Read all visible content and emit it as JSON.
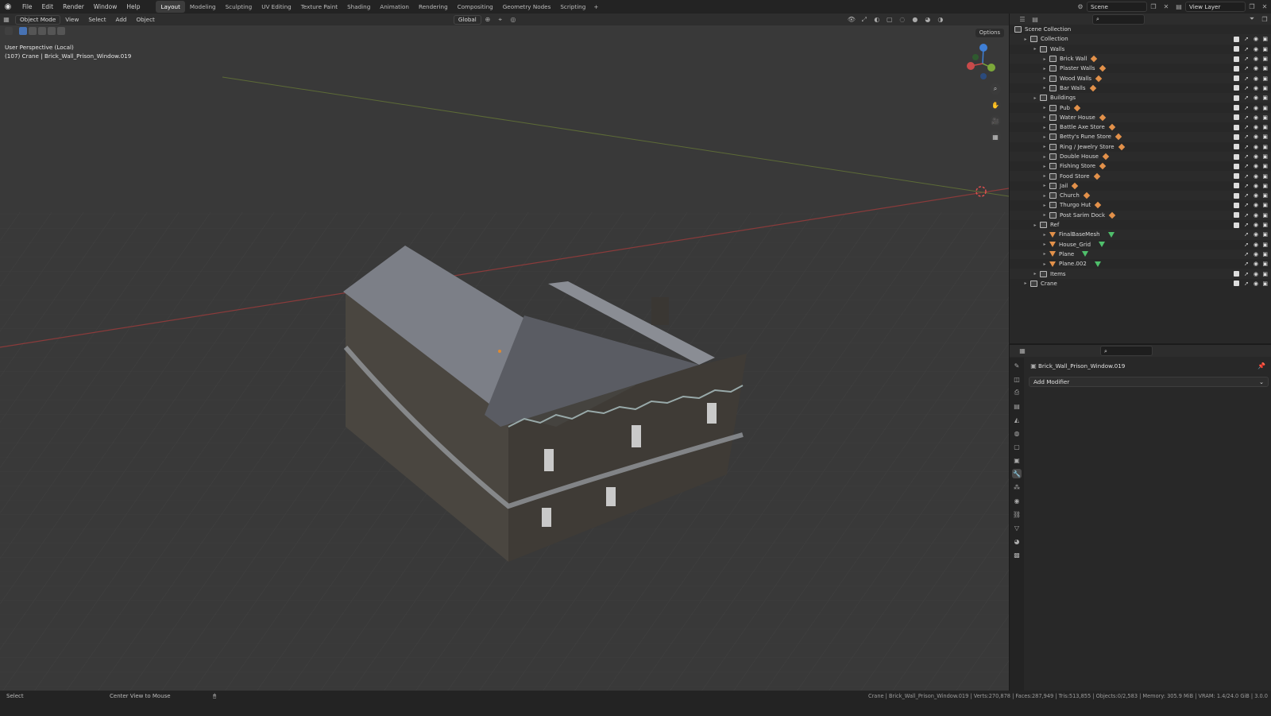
{
  "topbar": {
    "menus": [
      "File",
      "Edit",
      "Render",
      "Window",
      "Help"
    ],
    "workspaces": [
      "Layout",
      "Modeling",
      "Sculpting",
      "UV Editing",
      "Texture Paint",
      "Shading",
      "Animation",
      "Rendering",
      "Compositing",
      "Geometry Nodes",
      "Scripting"
    ],
    "active_workspace": "Layout",
    "scene": "Scene",
    "view_layer": "View Layer"
  },
  "viewport": {
    "mode": "Object Mode",
    "menus": [
      "View",
      "Select",
      "Add",
      "Object"
    ],
    "orientation": "Global",
    "options": "Options",
    "info_line1": "User Perspective (Local)",
    "info_line2": "(107) Crane | Brick_Wall_Prison_Window.019"
  },
  "outliner": {
    "rows": [
      {
        "label": "Scene Collection",
        "kind": "root",
        "indent": 0
      },
      {
        "label": "Collection",
        "kind": "coll",
        "indent": 1
      },
      {
        "label": "Walls",
        "kind": "coll",
        "indent": 2
      },
      {
        "label": "Brick Wall",
        "kind": "coll",
        "indent": 3
      },
      {
        "label": "Plaster Walls",
        "kind": "coll",
        "indent": 3
      },
      {
        "label": "Wood Walls",
        "kind": "coll",
        "indent": 3
      },
      {
        "label": "Bar Walls",
        "kind": "coll",
        "indent": 3
      },
      {
        "label": "Buildings",
        "kind": "coll",
        "indent": 2
      },
      {
        "label": "Pub",
        "kind": "coll",
        "indent": 3
      },
      {
        "label": "Water House",
        "kind": "coll",
        "indent": 3
      },
      {
        "label": "Battle Axe Store",
        "kind": "coll",
        "indent": 3
      },
      {
        "label": "Betty's Rune Store",
        "kind": "coll",
        "indent": 3
      },
      {
        "label": "Ring / Jewelry Store",
        "kind": "coll",
        "indent": 3
      },
      {
        "label": "Double House",
        "kind": "coll",
        "indent": 3
      },
      {
        "label": "Fishing Store",
        "kind": "coll",
        "indent": 3
      },
      {
        "label": "Food Store",
        "kind": "coll",
        "indent": 3
      },
      {
        "label": "Jail",
        "kind": "coll",
        "indent": 3
      },
      {
        "label": "Church",
        "kind": "coll",
        "indent": 3
      },
      {
        "label": "Thurgo Hut",
        "kind": "coll",
        "indent": 3
      },
      {
        "label": "Post Sarim Dock",
        "kind": "coll",
        "indent": 3
      },
      {
        "label": "Ref",
        "kind": "coll",
        "indent": 2
      },
      {
        "label": "FinalBaseMesh",
        "kind": "obj",
        "indent": 3
      },
      {
        "label": "House_Grid",
        "kind": "obj",
        "indent": 3
      },
      {
        "label": "Plane",
        "kind": "obj",
        "indent": 3
      },
      {
        "label": "Plane.002",
        "kind": "obj",
        "indent": 3
      },
      {
        "label": "Items",
        "kind": "coll",
        "indent": 2
      },
      {
        "label": "Crane",
        "kind": "coll",
        "indent": 1
      }
    ]
  },
  "properties": {
    "object_name": "Brick_Wall_Prison_Window.019",
    "add_modifier": "Add Modifier"
  },
  "statusbar": {
    "left1": "Select",
    "left2": "Center View to Mouse",
    "stats": "Crane | Brick_Wall_Prison_Window.019 | Verts:270,878 | Faces:287,949 | Tris:513,855 | Objects:0/2,583 | Memory: 305.9 MiB | VRAM: 1.4/24.0 GiB | 3.0.0"
  },
  "colors": {
    "accent": "#4772b3",
    "active_tab": "#3c3c3c",
    "object_icon": "#e3914a",
    "mesh_icon": "#4fbf6b",
    "x_axis": "#c94a4a",
    "y_axis": "#7ca83a",
    "z_axis": "#3f7fd6"
  }
}
